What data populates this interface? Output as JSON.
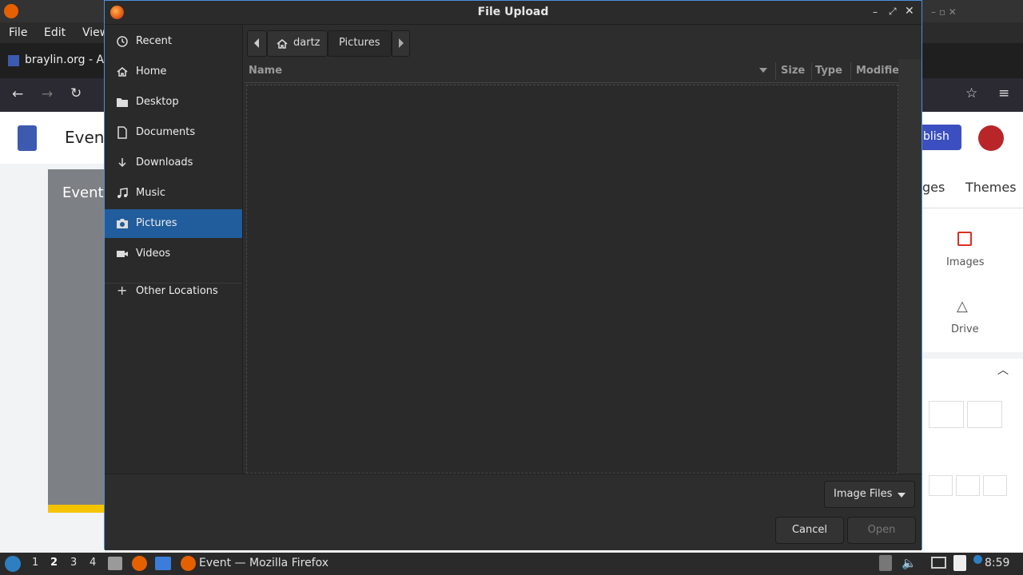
{
  "background": {
    "menu": [
      "File",
      "Edit",
      "View"
    ],
    "tab_title": "braylin.org - Ab",
    "page_title": "Event",
    "publish_label": "blish",
    "tabs_partial": "ges",
    "themes_label": "Themes",
    "images_label": "Images",
    "drive_label": "Drive",
    "hero_text": "Event"
  },
  "dialog": {
    "title": "File Upload",
    "sidebar": [
      {
        "label": "Recent",
        "icon": "clock-icon"
      },
      {
        "label": "Home",
        "icon": "home-icon"
      },
      {
        "label": "Desktop",
        "icon": "folder-icon"
      },
      {
        "label": "Documents",
        "icon": "document-icon"
      },
      {
        "label": "Downloads",
        "icon": "download-icon"
      },
      {
        "label": "Music",
        "icon": "music-icon"
      },
      {
        "label": "Pictures",
        "icon": "camera-icon",
        "selected": true
      },
      {
        "label": "Videos",
        "icon": "video-icon"
      }
    ],
    "other_locations": "Other Locations",
    "path": [
      "dartz",
      "Pictures"
    ],
    "columns": {
      "name": "Name",
      "size": "Size",
      "type": "Type",
      "modified": "Modifie"
    },
    "filter": "Image Files",
    "cancel": "Cancel",
    "open": "Open"
  },
  "taskbar": {
    "workspaces": [
      "1",
      "2",
      "3",
      "4"
    ],
    "active_window": "Event — Mozilla Firefox",
    "clock": "8:59"
  },
  "colors": {
    "accent": "#215d9c",
    "dialog_border": "#4a90d9",
    "publish": "#3c4fc0"
  }
}
